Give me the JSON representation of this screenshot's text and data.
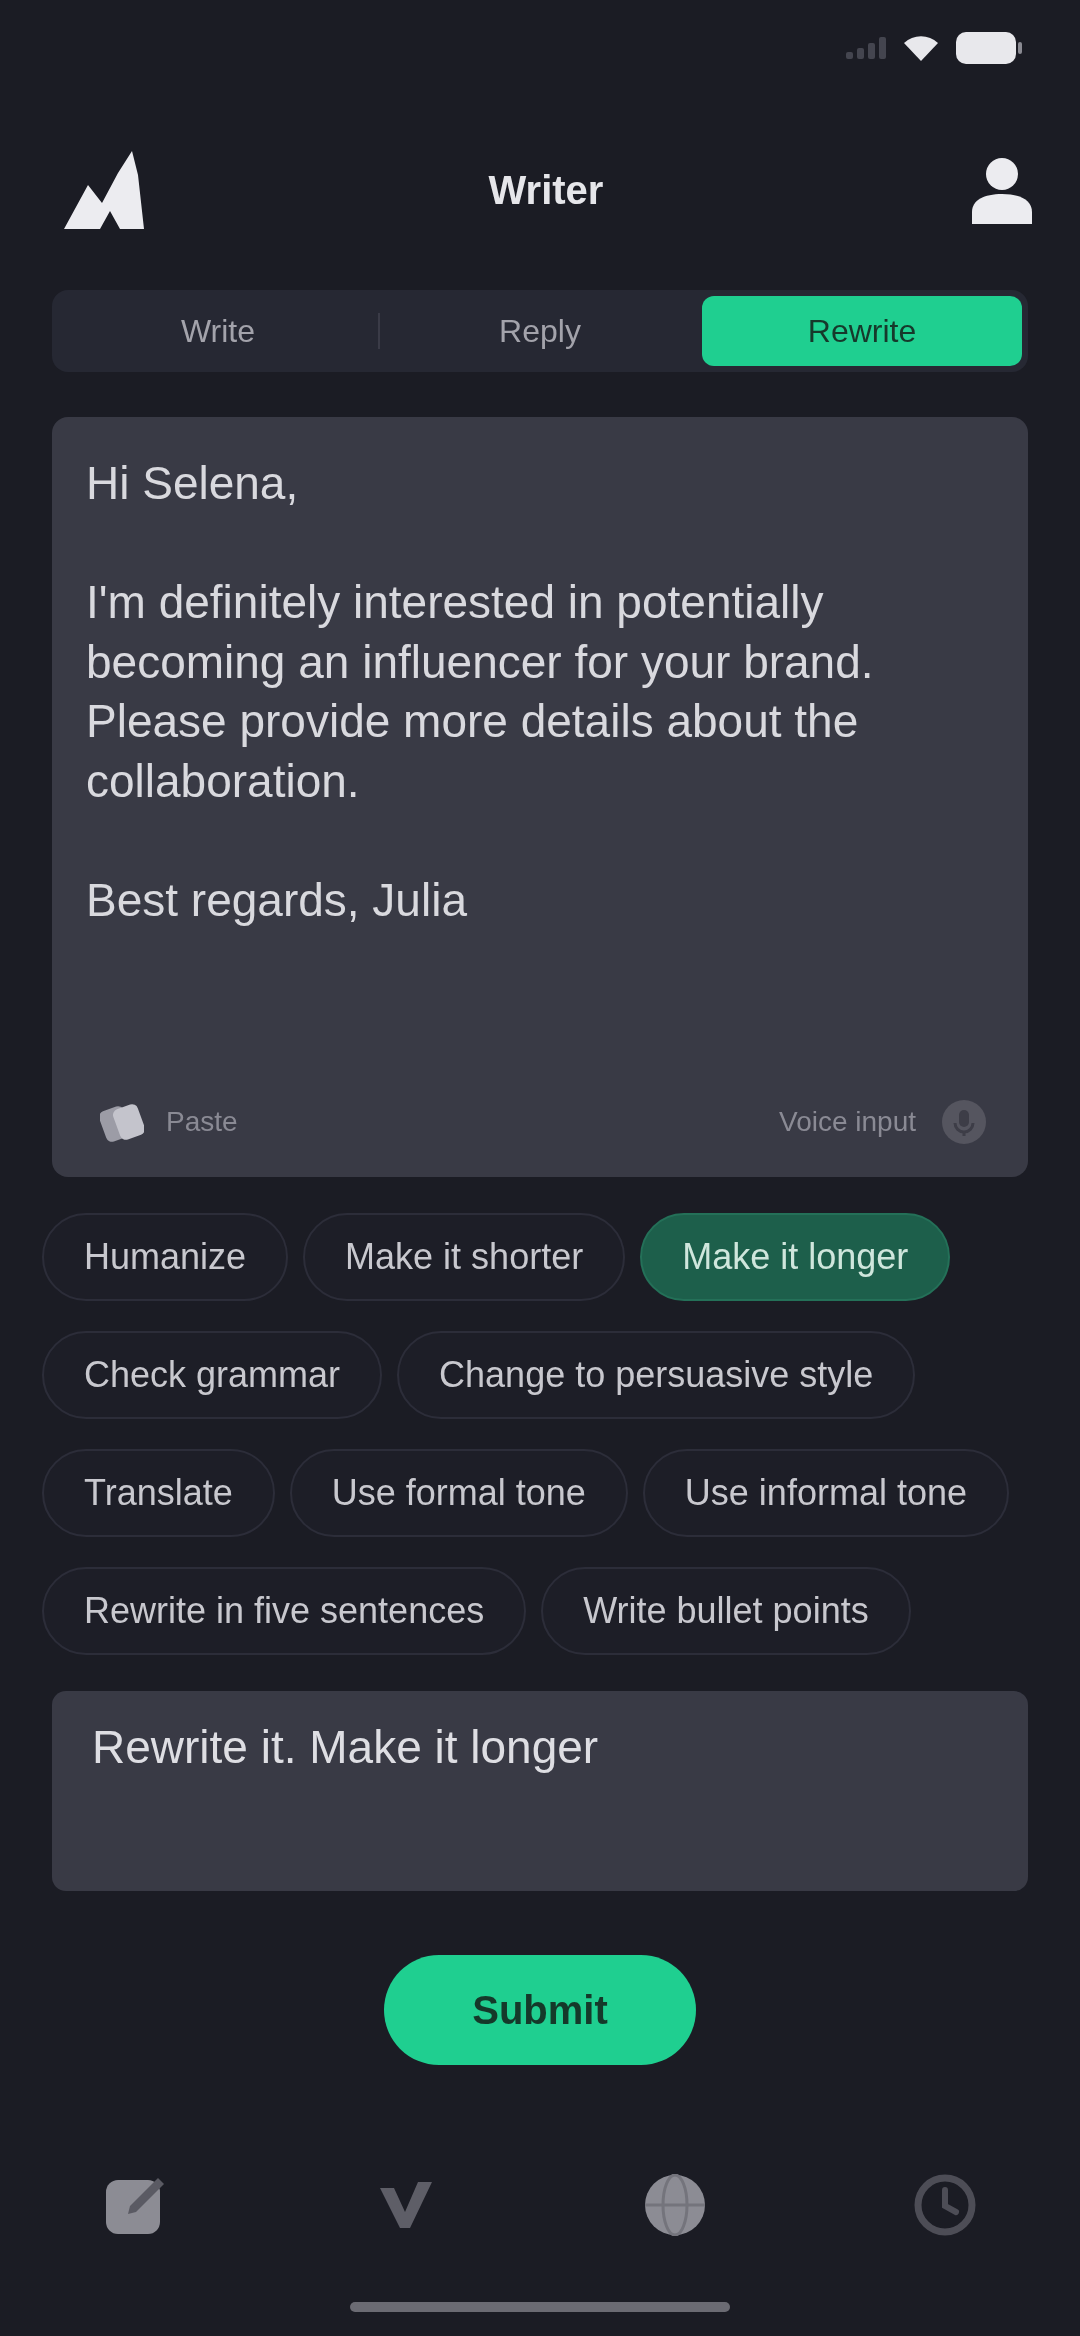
{
  "header": {
    "title": "Writer"
  },
  "tabs": [
    {
      "label": "Write",
      "selected": false
    },
    {
      "label": "Reply",
      "selected": false
    },
    {
      "label": "Rewrite",
      "selected": true
    }
  ],
  "editor": {
    "paragraphs": [
      "Hi Selena,",
      "I'm definitely interested in potentially becoming an influencer for your brand. Please provide more details about the collaboration.",
      "Best regards, Julia"
    ],
    "paste_label": "Paste",
    "voice_label": "Voice input"
  },
  "chips": [
    {
      "label": "Humanize",
      "selected": false
    },
    {
      "label": "Make it shorter",
      "selected": false
    },
    {
      "label": "Make it longer",
      "selected": true
    },
    {
      "label": "Check grammar",
      "selected": false
    },
    {
      "label": "Change to persuasive style",
      "selected": false
    },
    {
      "label": "Translate",
      "selected": false
    },
    {
      "label": "Use formal tone",
      "selected": false
    },
    {
      "label": "Use informal tone",
      "selected": false
    },
    {
      "label": "Rewrite in five sentences",
      "selected": false
    },
    {
      "label": "Write bullet points",
      "selected": false
    }
  ],
  "prompt": {
    "value": "Rewrite it. Make it longer"
  },
  "submit": {
    "label": "Submit"
  }
}
